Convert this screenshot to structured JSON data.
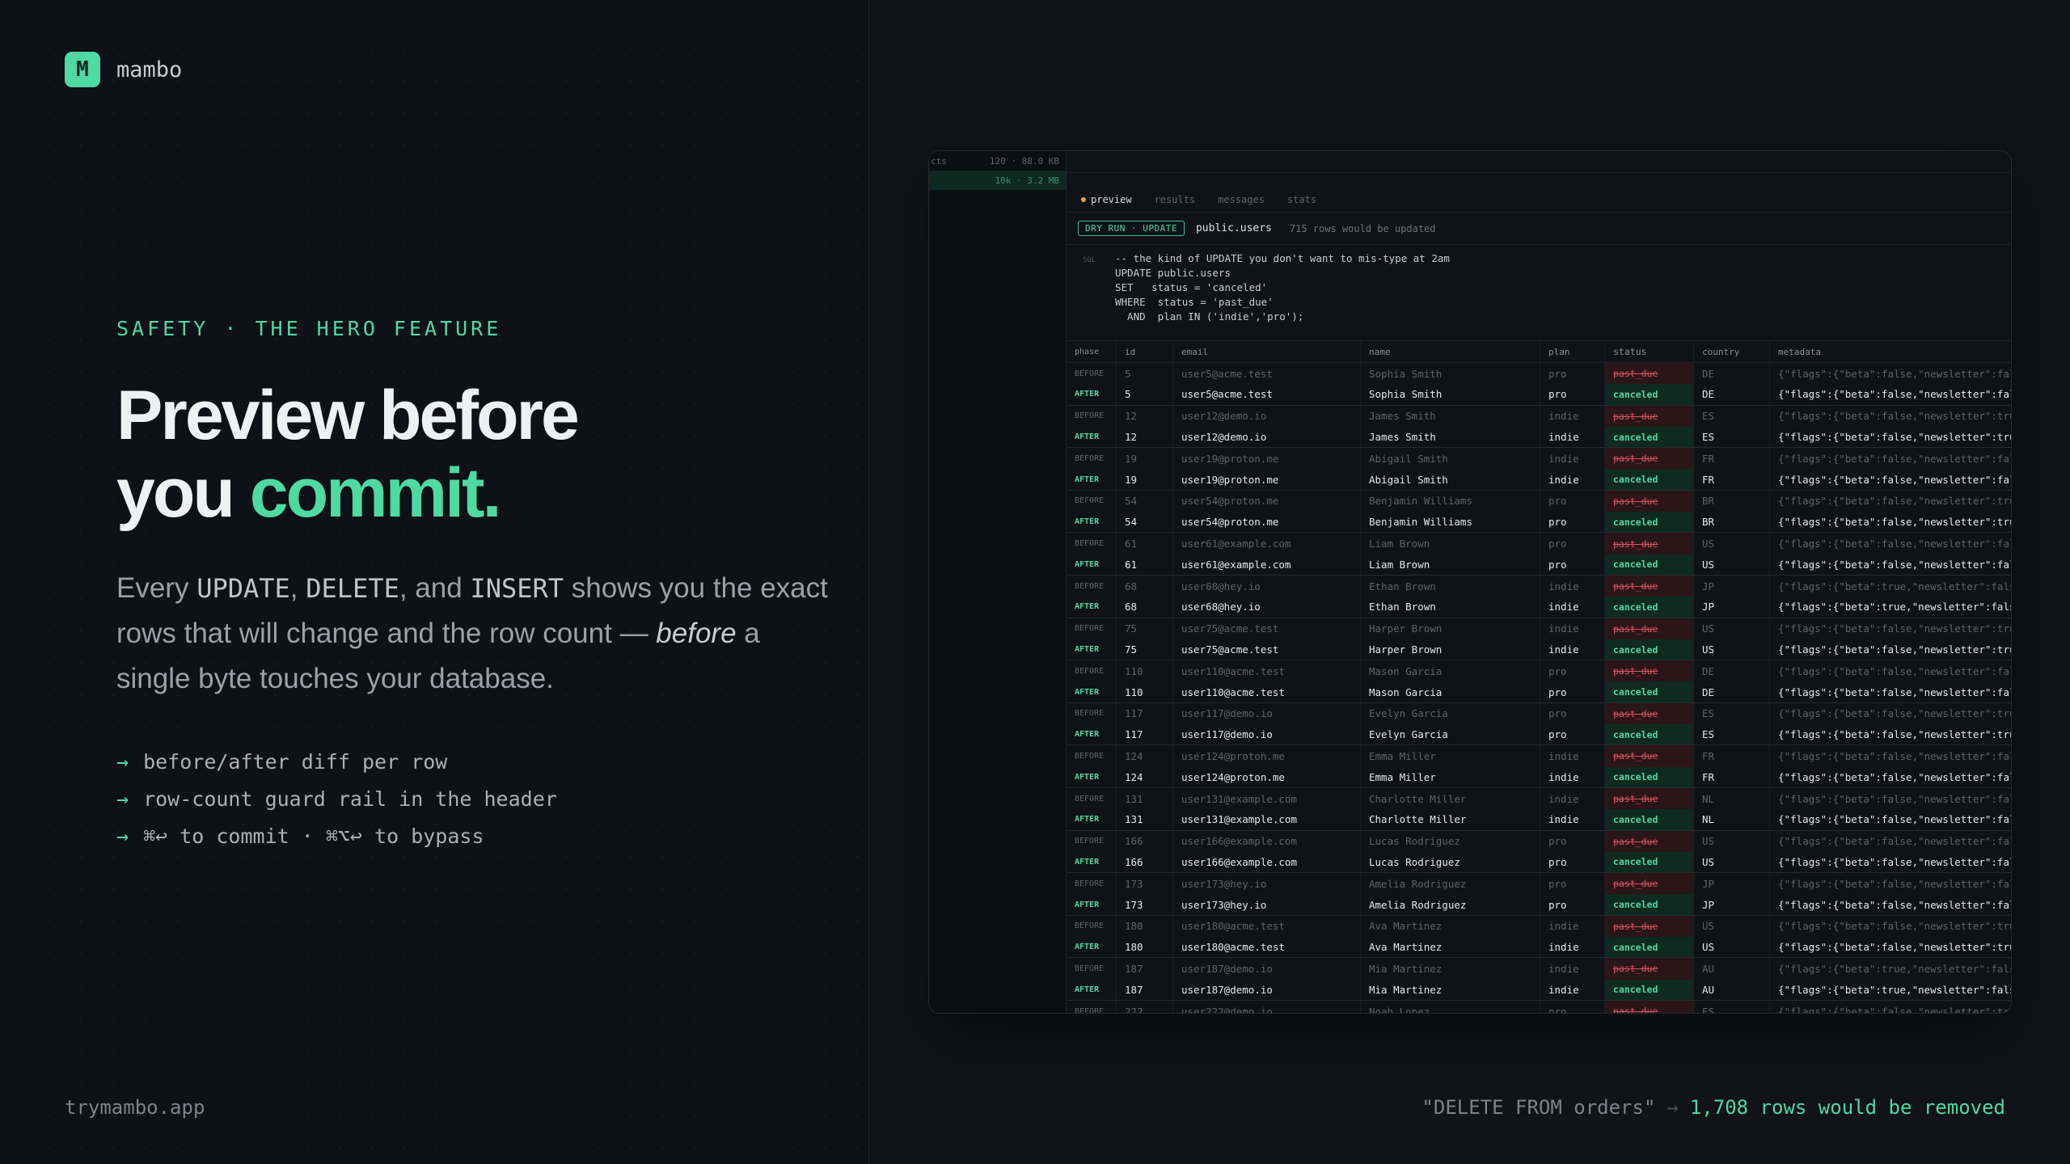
{
  "brand": {
    "mark": "M",
    "name": "mambo"
  },
  "hero": {
    "eyebrow": "SAFETY · THE HERO FEATURE",
    "headline_line1": "Preview before",
    "headline_line2_prefix": "you ",
    "headline_accent": "commit.",
    "lede": {
      "p1": "Every ",
      "k1": "UPDATE",
      "p2": ", ",
      "k2": "DELETE",
      "p3": ", and ",
      "k3": "INSERT",
      "p4": " shows you the exact rows that will change and the row count — ",
      "em": "before",
      "p5": " a single byte touches your database."
    },
    "bullets": [
      "before/after diff per row",
      "row-count guard rail in the header",
      "⌘↩ to commit · ⌘⌥↩ to bypass"
    ],
    "arrow": "→"
  },
  "footer": {
    "url": "trymambo.app",
    "caption_query": "\"DELETE FROM orders\"",
    "caption_sep": "→",
    "caption_result": "1,708 rows would be removed"
  },
  "app": {
    "sidebar": [
      {
        "label": "cts",
        "meta": "120 · 88.0 KB",
        "active": false
      },
      {
        "label": "",
        "meta": "10k · 3.2 MB",
        "active": true
      }
    ],
    "tabs": [
      "preview",
      "results",
      "messages",
      "stats"
    ],
    "active_tab": "preview",
    "badge": "DRY RUN · UPDATE",
    "table_name": "public.users",
    "row_count_text": "715 rows would be updated",
    "sql_label": "SQL",
    "sql_lines": [
      "-- the kind of UPDATE you don't want to mis-type at 2am",
      "UPDATE public.users",
      "SET   status = 'canceled'",
      "WHERE  status = 'past_due'",
      "  AND  plan IN ('indie','pro');"
    ],
    "columns": [
      "phase",
      "id",
      "email",
      "name",
      "plan",
      "status",
      "country",
      "metadata"
    ],
    "rows": [
      {
        "phase": "BEFORE",
        "id": "5",
        "email": "user5@acme.test",
        "name": "Sophia Smith",
        "plan": "pro",
        "status": "past_due",
        "country": "DE",
        "metadata": "{\"flags\":{\"beta\":false,\"newsletter\":false}}"
      },
      {
        "phase": "AFTER",
        "id": "5",
        "email": "user5@acme.test",
        "name": "Sophia Smith",
        "plan": "pro",
        "status": "canceled",
        "country": "DE",
        "metadata": "{\"flags\":{\"beta\":false,\"newsletter\":false}}"
      },
      {
        "phase": "BEFORE",
        "id": "12",
        "email": "user12@demo.io",
        "name": "James Smith",
        "plan": "indie",
        "status": "past_due",
        "country": "ES",
        "metadata": "{\"flags\":{\"beta\":false,\"newsletter\":true}}"
      },
      {
        "phase": "AFTER",
        "id": "12",
        "email": "user12@demo.io",
        "name": "James Smith",
        "plan": "indie",
        "status": "canceled",
        "country": "ES",
        "metadata": "{\"flags\":{\"beta\":false,\"newsletter\":true}}"
      },
      {
        "phase": "BEFORE",
        "id": "19",
        "email": "user19@proton.me",
        "name": "Abigail Smith",
        "plan": "indie",
        "status": "past_due",
        "country": "FR",
        "metadata": "{\"flags\":{\"beta\":false,\"newsletter\":false}}"
      },
      {
        "phase": "AFTER",
        "id": "19",
        "email": "user19@proton.me",
        "name": "Abigail Smith",
        "plan": "indie",
        "status": "canceled",
        "country": "FR",
        "metadata": "{\"flags\":{\"beta\":false,\"newsletter\":false}}"
      },
      {
        "phase": "BEFORE",
        "id": "54",
        "email": "user54@proton.me",
        "name": "Benjamin Williams",
        "plan": "pro",
        "status": "past_due",
        "country": "BR",
        "metadata": "{\"flags\":{\"beta\":false,\"newsletter\":true}}"
      },
      {
        "phase": "AFTER",
        "id": "54",
        "email": "user54@proton.me",
        "name": "Benjamin Williams",
        "plan": "pro",
        "status": "canceled",
        "country": "BR",
        "metadata": "{\"flags\":{\"beta\":false,\"newsletter\":true}}"
      },
      {
        "phase": "BEFORE",
        "id": "61",
        "email": "user61@example.com",
        "name": "Liam Brown",
        "plan": "pro",
        "status": "past_due",
        "country": "US",
        "metadata": "{\"flags\":{\"beta\":false,\"newsletter\":false}}"
      },
      {
        "phase": "AFTER",
        "id": "61",
        "email": "user61@example.com",
        "name": "Liam Brown",
        "plan": "pro",
        "status": "canceled",
        "country": "US",
        "metadata": "{\"flags\":{\"beta\":false,\"newsletter\":false}}"
      },
      {
        "phase": "BEFORE",
        "id": "68",
        "email": "user68@hey.io",
        "name": "Ethan Brown",
        "plan": "indie",
        "status": "past_due",
        "country": "JP",
        "metadata": "{\"flags\":{\"beta\":true,\"newsletter\":false}}"
      },
      {
        "phase": "AFTER",
        "id": "68",
        "email": "user68@hey.io",
        "name": "Ethan Brown",
        "plan": "indie",
        "status": "canceled",
        "country": "JP",
        "metadata": "{\"flags\":{\"beta\":true,\"newsletter\":false}}"
      },
      {
        "phase": "BEFORE",
        "id": "75",
        "email": "user75@acme.test",
        "name": "Harper Brown",
        "plan": "indie",
        "status": "past_due",
        "country": "US",
        "metadata": "{\"flags\":{\"beta\":false,\"newsletter\":true}}"
      },
      {
        "phase": "AFTER",
        "id": "75",
        "email": "user75@acme.test",
        "name": "Harper Brown",
        "plan": "indie",
        "status": "canceled",
        "country": "US",
        "metadata": "{\"flags\":{\"beta\":false,\"newsletter\":true}}"
      },
      {
        "phase": "BEFORE",
        "id": "110",
        "email": "user110@acme.test",
        "name": "Mason Garcia",
        "plan": "pro",
        "status": "past_due",
        "country": "DE",
        "metadata": "{\"flags\":{\"beta\":false,\"newsletter\":false}}"
      },
      {
        "phase": "AFTER",
        "id": "110",
        "email": "user110@acme.test",
        "name": "Mason Garcia",
        "plan": "pro",
        "status": "canceled",
        "country": "DE",
        "metadata": "{\"flags\":{\"beta\":false,\"newsletter\":false}}"
      },
      {
        "phase": "BEFORE",
        "id": "117",
        "email": "user117@demo.io",
        "name": "Evelyn Garcia",
        "plan": "pro",
        "status": "past_due",
        "country": "ES",
        "metadata": "{\"flags\":{\"beta\":false,\"newsletter\":true}}"
      },
      {
        "phase": "AFTER",
        "id": "117",
        "email": "user117@demo.io",
        "name": "Evelyn Garcia",
        "plan": "pro",
        "status": "canceled",
        "country": "ES",
        "metadata": "{\"flags\":{\"beta\":false,\"newsletter\":true}}"
      },
      {
        "phase": "BEFORE",
        "id": "124",
        "email": "user124@proton.me",
        "name": "Emma Miller",
        "plan": "indie",
        "status": "past_due",
        "country": "FR",
        "metadata": "{\"flags\":{\"beta\":false,\"newsletter\":false}}"
      },
      {
        "phase": "AFTER",
        "id": "124",
        "email": "user124@proton.me",
        "name": "Emma Miller",
        "plan": "indie",
        "status": "canceled",
        "country": "FR",
        "metadata": "{\"flags\":{\"beta\":false,\"newsletter\":false}}"
      },
      {
        "phase": "BEFORE",
        "id": "131",
        "email": "user131@example.com",
        "name": "Charlotte Miller",
        "plan": "indie",
        "status": "past_due",
        "country": "NL",
        "metadata": "{\"flags\":{\"beta\":false,\"newsletter\":false}}"
      },
      {
        "phase": "AFTER",
        "id": "131",
        "email": "user131@example.com",
        "name": "Charlotte Miller",
        "plan": "indie",
        "status": "canceled",
        "country": "NL",
        "metadata": "{\"flags\":{\"beta\":false,\"newsletter\":false}}"
      },
      {
        "phase": "BEFORE",
        "id": "166",
        "email": "user166@example.com",
        "name": "Lucas Rodriguez",
        "plan": "pro",
        "status": "past_due",
        "country": "US",
        "metadata": "{\"flags\":{\"beta\":false,\"newsletter\":false}}"
      },
      {
        "phase": "AFTER",
        "id": "166",
        "email": "user166@example.com",
        "name": "Lucas Rodriguez",
        "plan": "pro",
        "status": "canceled",
        "country": "US",
        "metadata": "{\"flags\":{\"beta\":false,\"newsletter\":false}}"
      },
      {
        "phase": "BEFORE",
        "id": "173",
        "email": "user173@hey.io",
        "name": "Amelia Rodriguez",
        "plan": "pro",
        "status": "past_due",
        "country": "JP",
        "metadata": "{\"flags\":{\"beta\":false,\"newsletter\":false}}"
      },
      {
        "phase": "AFTER",
        "id": "173",
        "email": "user173@hey.io",
        "name": "Amelia Rodriguez",
        "plan": "pro",
        "status": "canceled",
        "country": "JP",
        "metadata": "{\"flags\":{\"beta\":false,\"newsletter\":false}}"
      },
      {
        "phase": "BEFORE",
        "id": "180",
        "email": "user180@acme.test",
        "name": "Ava Martinez",
        "plan": "indie",
        "status": "past_due",
        "country": "US",
        "metadata": "{\"flags\":{\"beta\":false,\"newsletter\":true}}"
      },
      {
        "phase": "AFTER",
        "id": "180",
        "email": "user180@acme.test",
        "name": "Ava Martinez",
        "plan": "indie",
        "status": "canceled",
        "country": "US",
        "metadata": "{\"flags\":{\"beta\":false,\"newsletter\":true}}"
      },
      {
        "phase": "BEFORE",
        "id": "187",
        "email": "user187@demo.io",
        "name": "Mia Martinez",
        "plan": "indie",
        "status": "past_due",
        "country": "AU",
        "metadata": "{\"flags\":{\"beta\":true,\"newsletter\":false}}"
      },
      {
        "phase": "AFTER",
        "id": "187",
        "email": "user187@demo.io",
        "name": "Mia Martinez",
        "plan": "indie",
        "status": "canceled",
        "country": "AU",
        "metadata": "{\"flags\":{\"beta\":true,\"newsletter\":false}}"
      },
      {
        "phase": "BEFORE",
        "id": "222",
        "email": "user222@demo.io",
        "name": "Noah Lopez",
        "plan": "pro",
        "status": "past_due",
        "country": "ES",
        "metadata": "{\"flags\":{\"beta\":false,\"newsletter\":true}}"
      }
    ]
  },
  "colors": {
    "accent": "#4fd9a3",
    "background": "#0e1115",
    "before_status": "#d9555f",
    "after_status": "#4fd9a3"
  }
}
